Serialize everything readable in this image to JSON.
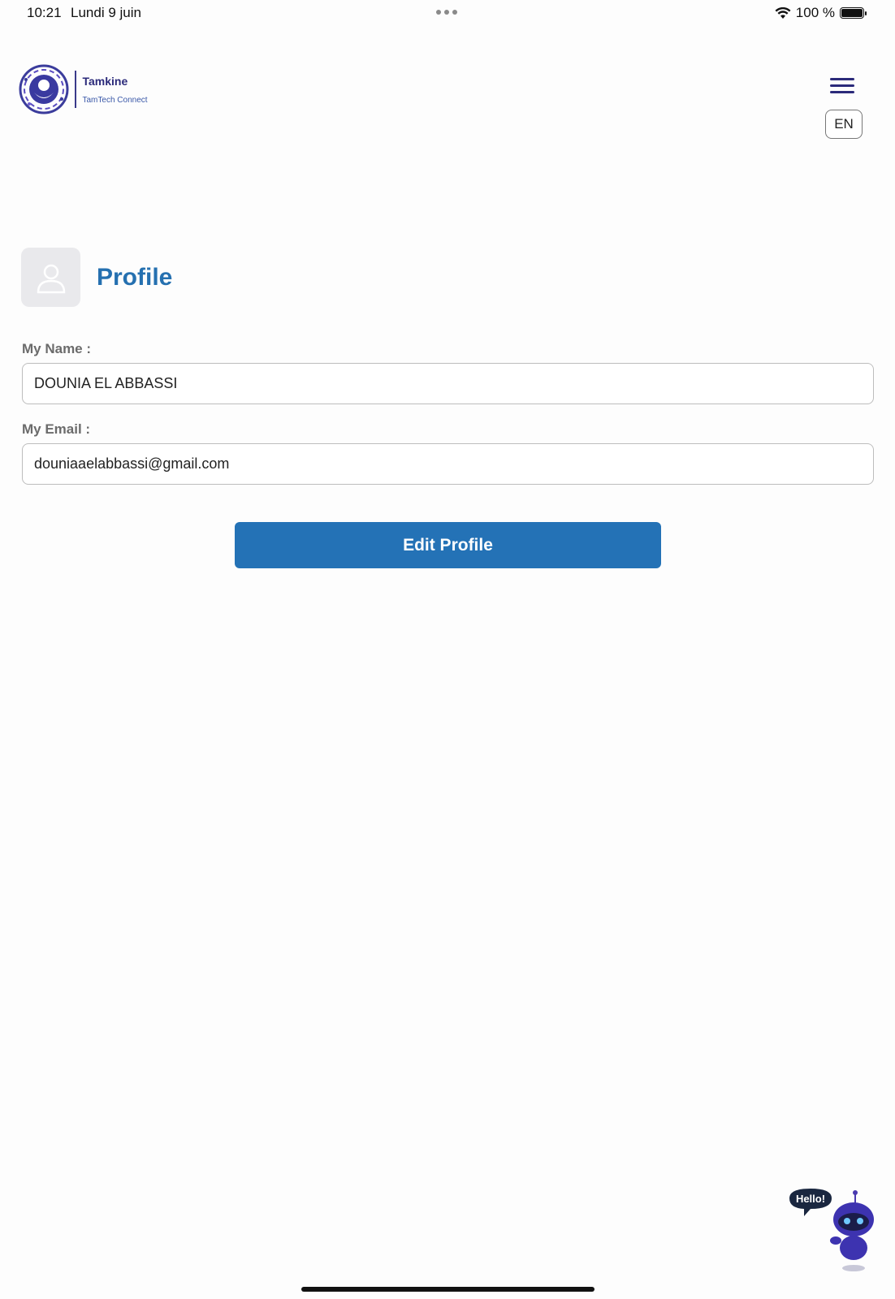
{
  "status_bar": {
    "time": "10:21",
    "date": "Lundi 9 juin",
    "battery": "100 %"
  },
  "brand": {
    "name": "Tamkine",
    "tagline": "TamTech Connect"
  },
  "header": {
    "language": "EN"
  },
  "profile": {
    "title": "Profile",
    "name_label": "My Name :",
    "name_value": "DOUNIA EL ABBASSI",
    "email_label": "My Email :",
    "email_value": "douniaaelabbassi@gmail.com",
    "edit_button": "Edit Profile"
  },
  "chatbot": {
    "bubble": "Hello!"
  },
  "colors": {
    "accent": "#2472b6",
    "brand": "#2b2a7a",
    "title": "#2570b0"
  }
}
